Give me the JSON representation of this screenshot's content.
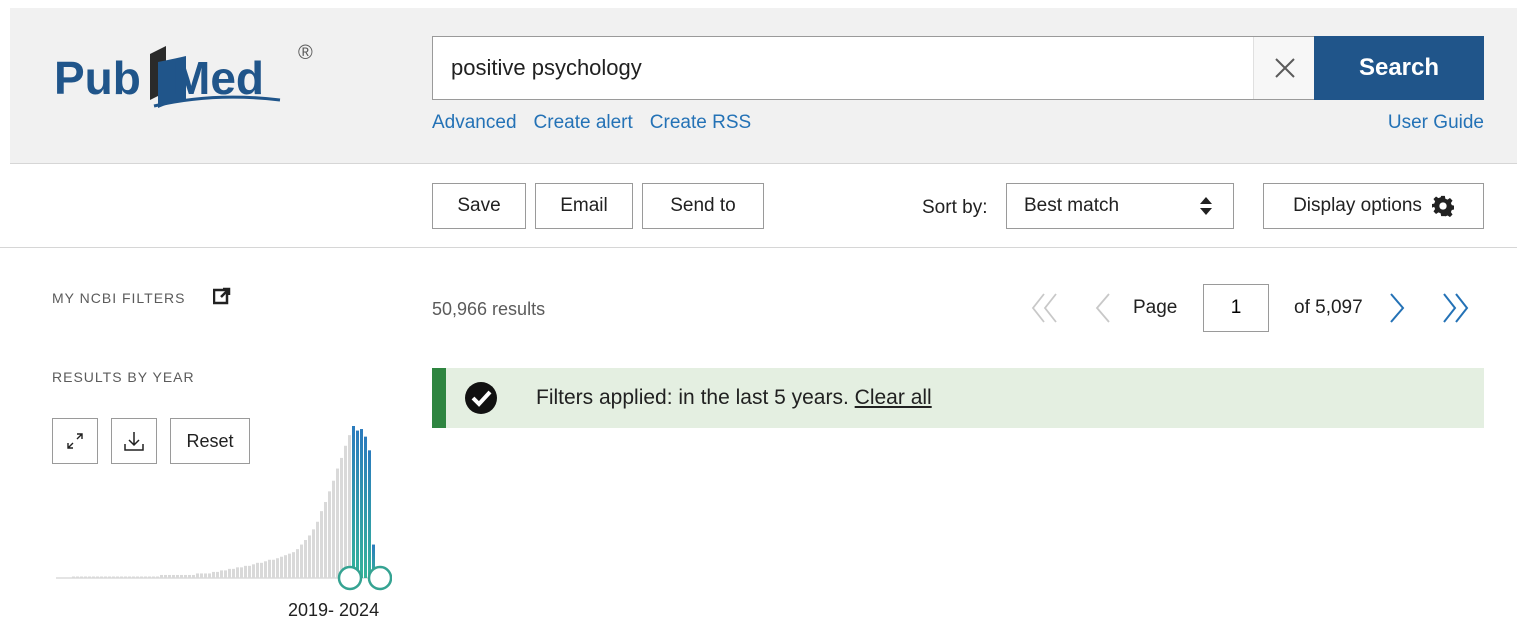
{
  "header": {
    "logo_text": "PubMed",
    "logo_mark": "®",
    "search_value": "positive psychology",
    "search_button": "Search",
    "links": [
      "Advanced",
      "Create alert",
      "Create RSS"
    ],
    "user_guide": "User Guide"
  },
  "toolbar": {
    "save": "Save",
    "email": "Email",
    "send_to": "Send to",
    "sort_label": "Sort by:",
    "sort_value": "Best match",
    "display_options": "Display options"
  },
  "sidebar": {
    "my_ncbi_filters": "MY NCBI FILTERS",
    "results_by_year": "RESULTS BY YEAR",
    "reset": "Reset",
    "year_range": "2019- 2024"
  },
  "results": {
    "count": "50,966 results",
    "page_label": "Page",
    "page_value": "1",
    "page_of": "of 5,097",
    "filter_text": "Filters applied: in the last 5 years.",
    "clear_all": "Clear all"
  },
  "colors": {
    "brand": "#20558a",
    "link": "#2472b6",
    "filter_accent": "#2e8540",
    "filter_bg": "#e4efe1",
    "selected_bar_top": "#2b7bbd",
    "selected_bar_bottom": "#35b39a"
  },
  "chart_data": {
    "type": "bar",
    "ylim": [
      0,
      100
    ],
    "values": [
      1,
      1,
      1,
      1,
      1,
      1,
      1,
      1,
      1,
      1,
      1,
      1,
      1,
      1,
      1,
      1,
      1,
      1,
      1,
      1,
      1,
      1,
      2,
      2,
      2,
      2,
      2,
      2,
      2,
      2,
      2,
      3,
      3,
      3,
      3,
      4,
      4,
      5,
      5,
      6,
      6,
      7,
      7,
      8,
      8,
      9,
      10,
      10,
      11,
      12,
      12,
      13,
      14,
      15,
      16,
      17,
      19,
      22,
      25,
      28,
      32,
      37,
      44,
      50,
      57,
      64,
      72,
      79,
      87,
      94,
      100,
      97,
      98,
      93,
      84,
      22
    ],
    "selected_from_index": 70,
    "selected_range": "2019- 2024"
  }
}
